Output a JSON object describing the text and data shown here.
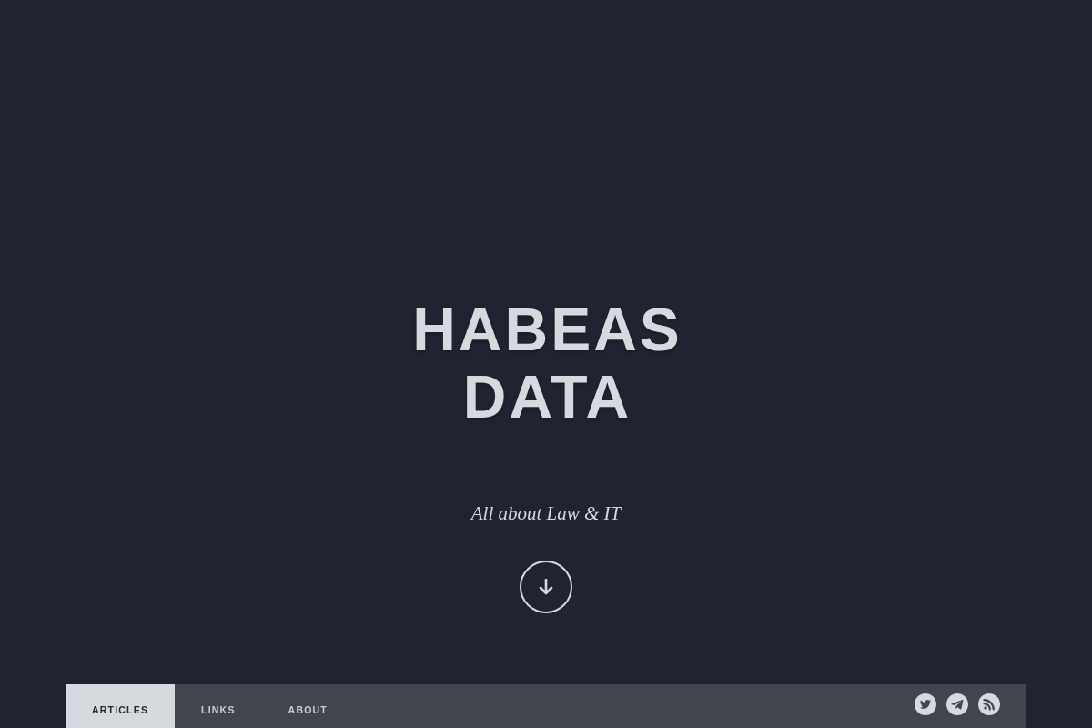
{
  "hero": {
    "title": "HABEAS DATA",
    "tagline": "All about Law & IT"
  },
  "nav": {
    "tabs": [
      {
        "label": "ARTICLES",
        "selected": true
      },
      {
        "label": "LINKS",
        "selected": false
      },
      {
        "label": "ABOUT",
        "selected": false
      }
    ]
  }
}
